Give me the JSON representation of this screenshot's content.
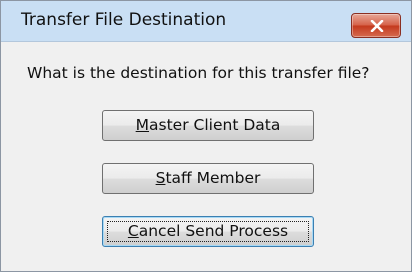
{
  "dialog": {
    "title": "Transfer File Destination",
    "close_icon": "close-x-icon",
    "prompt": "What is the destination for this transfer file?",
    "buttons": [
      {
        "label": "Master Client Data",
        "accelerator": "M"
      },
      {
        "label": "Staff Member",
        "accelerator": "S"
      },
      {
        "label": "Cancel Send Process",
        "accelerator": "C",
        "default": true
      }
    ]
  },
  "colors": {
    "titlebar": "#c9dff4",
    "close_button": "#c4391d",
    "dialog_background": "#f0f0f0",
    "default_button_border": "#3c7fb1"
  }
}
